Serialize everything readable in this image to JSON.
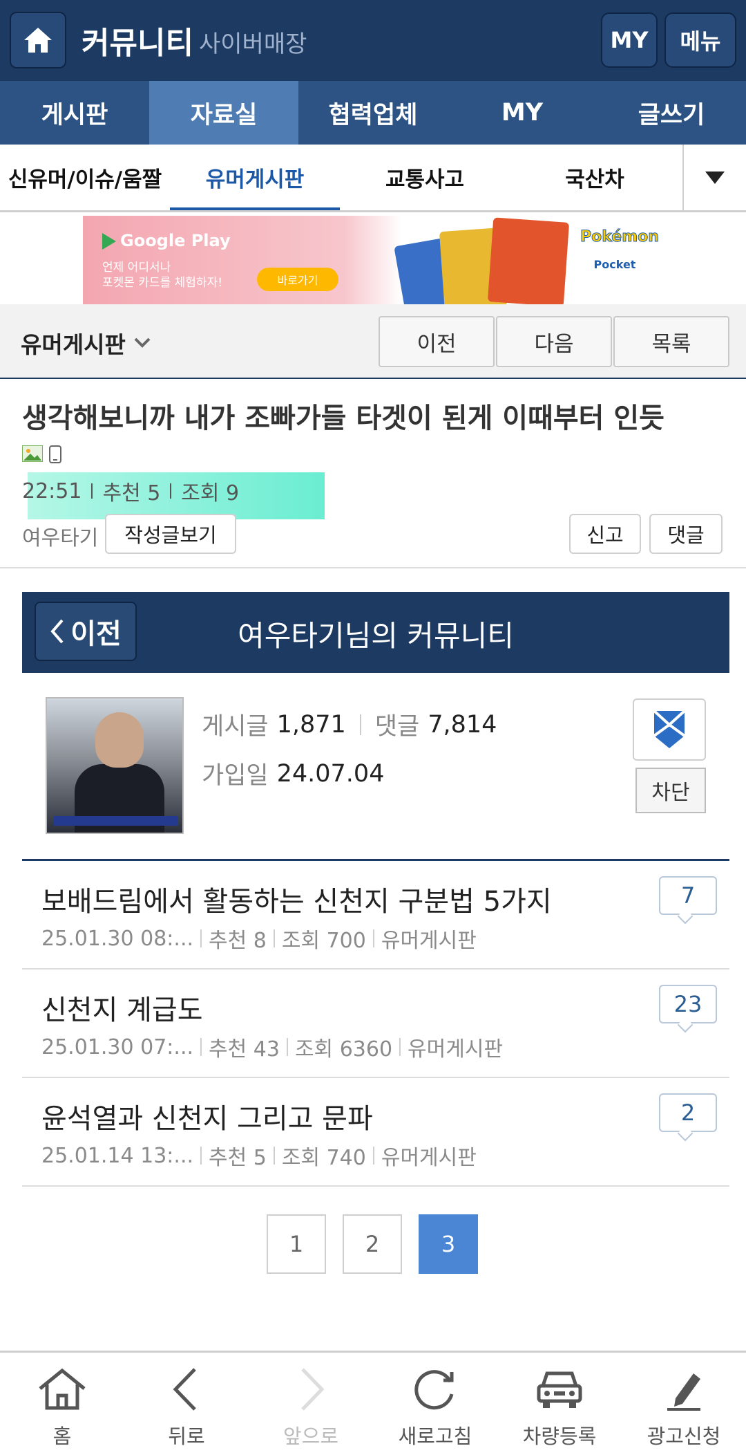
{
  "header": {
    "title": "커뮤니티",
    "subtitle": "사이버매장",
    "my_label": "MY",
    "menu_label": "메뉴"
  },
  "main_nav": [
    "게시판",
    "자료실",
    "협력업체",
    "MY",
    "글쓰기"
  ],
  "sub_nav": [
    "신유머/이슈/움짤",
    "유머게시판",
    "교통사고",
    "국산차"
  ],
  "ad": {
    "store": "Google Play",
    "line1": "언제 어디서나",
    "line2": "포켓몬 카드를 체험하자!",
    "button": "바로가기",
    "brand": "Pokémon",
    "brand_sub": "Pocket"
  },
  "board": {
    "title": "유머게시판",
    "prev": "이전",
    "next": "다음",
    "list": "목록"
  },
  "post": {
    "title": "생각해보니까 내가 조빠가들 타겟이 된게 이때부터 인듯",
    "time": "22:51",
    "recommend": "추천 5",
    "views": "조회 9",
    "author": "여우타기",
    "view_posts": "작성글보기",
    "report": "신고",
    "comment": "댓글"
  },
  "community": {
    "back": "이전",
    "title": "여우타기님의 커뮤니티",
    "posts_label": "게시글",
    "posts_value": "1,871",
    "comments_label": "댓글",
    "comments_value": "7,814",
    "joined_label": "가입일",
    "joined_value": "24.07.04",
    "block": "차단"
  },
  "list": [
    {
      "title": "보배드림에서 활동하는 신천지 구분법 5가지",
      "date": "25.01.30  08:...",
      "rec": "추천 8",
      "views": "조회 700",
      "board": "유머게시판",
      "count": "7"
    },
    {
      "title": "신천지 계급도",
      "date": "25.01.30  07:...",
      "rec": "추천 43",
      "views": "조회 6360",
      "board": "유머게시판",
      "count": "23"
    },
    {
      "title": "윤석열과 신천지 그리고 문파",
      "date": "25.01.14  13:...",
      "rec": "추천 5",
      "views": "조회 740",
      "board": "유머게시판",
      "count": "2"
    }
  ],
  "pagination": [
    "1",
    "2",
    "3"
  ],
  "pagination_active": "3",
  "bottom_bar": [
    "홈",
    "뒤로",
    "앞으로",
    "새로고침",
    "차량등록",
    "광고신청"
  ],
  "colors": {
    "header": "#1d3a63",
    "nav": "#2d5384",
    "nav_active": "#4f7db3",
    "accent": "#1c58a8",
    "page_active": "#4a86d4"
  }
}
